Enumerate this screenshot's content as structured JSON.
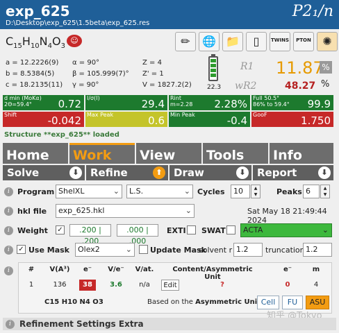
{
  "header": {
    "title": "exp_625",
    "path": "D:\\Desktop\\exp_625\\1.5beta\\exp_625.res",
    "space_group": "P2₁/n"
  },
  "formula": {
    "text": "C15H10N4O3",
    "parts": [
      [
        "C",
        "15"
      ],
      [
        "H",
        "10"
      ],
      [
        "N",
        "4"
      ],
      [
        "O",
        "3"
      ]
    ]
  },
  "toolbar": {
    "twins_label": "TWINS",
    "pton_label": "PTON"
  },
  "cell": {
    "a": "a = 12.2226(9)",
    "b": "b = 8.5384(5)",
    "c": "c = 18.2135(11)",
    "alpha": "α = 90°",
    "beta": "β = 105.999(7)°",
    "gamma": "γ = 90°",
    "Z": "Z = 4",
    "Zp": "Z' = 1",
    "V": "V = 1827.2(2)"
  },
  "battery": {
    "value": "22.3",
    "level_fraction": 0.85
  },
  "rfactors": {
    "r1_label": "R1",
    "r1_value": "11.87",
    "wr2_label": "wR2",
    "wr2_value": "48.27",
    "pct": "%"
  },
  "metrics": [
    {
      "label": "d min (MoKα)\n2Θ=59.4°",
      "value": "0.72",
      "color": "green"
    },
    {
      "label": "I/σ(I)",
      "value": "29.4",
      "color": "green"
    },
    {
      "label": "Rint\nm=2.28",
      "value": "2.28%",
      "color": "green"
    },
    {
      "label": "Full 50.5°\n86% to 59.4°",
      "value": "99.9",
      "color": "green"
    },
    {
      "label": "Shift",
      "value": "-0.042",
      "color": "red"
    },
    {
      "label": "Max Peak",
      "value": "0.6",
      "color": "yellow"
    },
    {
      "label": "Min Peak",
      "value": "-0.4",
      "color": "green"
    },
    {
      "label": "GooF",
      "value": "1.750",
      "color": "red"
    }
  ],
  "status": "Structure **exp_625** loaded",
  "main_tabs": [
    "Home",
    "Work",
    "View",
    "Tools",
    "Info"
  ],
  "sub_tabs": [
    "Solve",
    "Refine",
    "Draw",
    "Report"
  ],
  "form": {
    "program_label": "Program",
    "program_value": "ShelXL",
    "method_value": "L.S.",
    "cycles_label": "Cycles",
    "cycles_value": "10",
    "peaks_label": "Peaks",
    "peaks_value": "6",
    "hkl_label": "hkl file",
    "hkl_value": "exp_625.hkl",
    "date": "Sat May 18 21:49:44 2024",
    "weight_label": "Weight",
    "weight1": ".200 | .200",
    "weight2": ".000 | .000",
    "exti_label": "EXTI",
    "swat_label": "SWAT",
    "acta_value": "ACTA",
    "mask_label": "Use Mask",
    "mask_value": "Olex2",
    "update_mask_label": "Update Mask",
    "solvent_label": "solvent r",
    "solvent_value": "1.2",
    "truncation_label": "truncation",
    "truncation_value": "1.2"
  },
  "table": {
    "headers": [
      "#",
      "V(A³)",
      "e⁻",
      "V/e⁻",
      "V/at.",
      "Content/Asymmetric Unit",
      "e⁻",
      "m"
    ],
    "row": [
      "1",
      "136",
      "38",
      "3.6",
      "n/a",
      "Edit",
      "?",
      "0",
      "4"
    ],
    "formula": "C15 H10 N4 O3",
    "basis_prefix": "Based on the ",
    "basis_strong": "Asymmetric Unit",
    "buttons": [
      "Cell",
      "FU",
      "ASU"
    ]
  },
  "section": "Refinement Settings Extra",
  "watermark": "知乎 @Tokyo"
}
